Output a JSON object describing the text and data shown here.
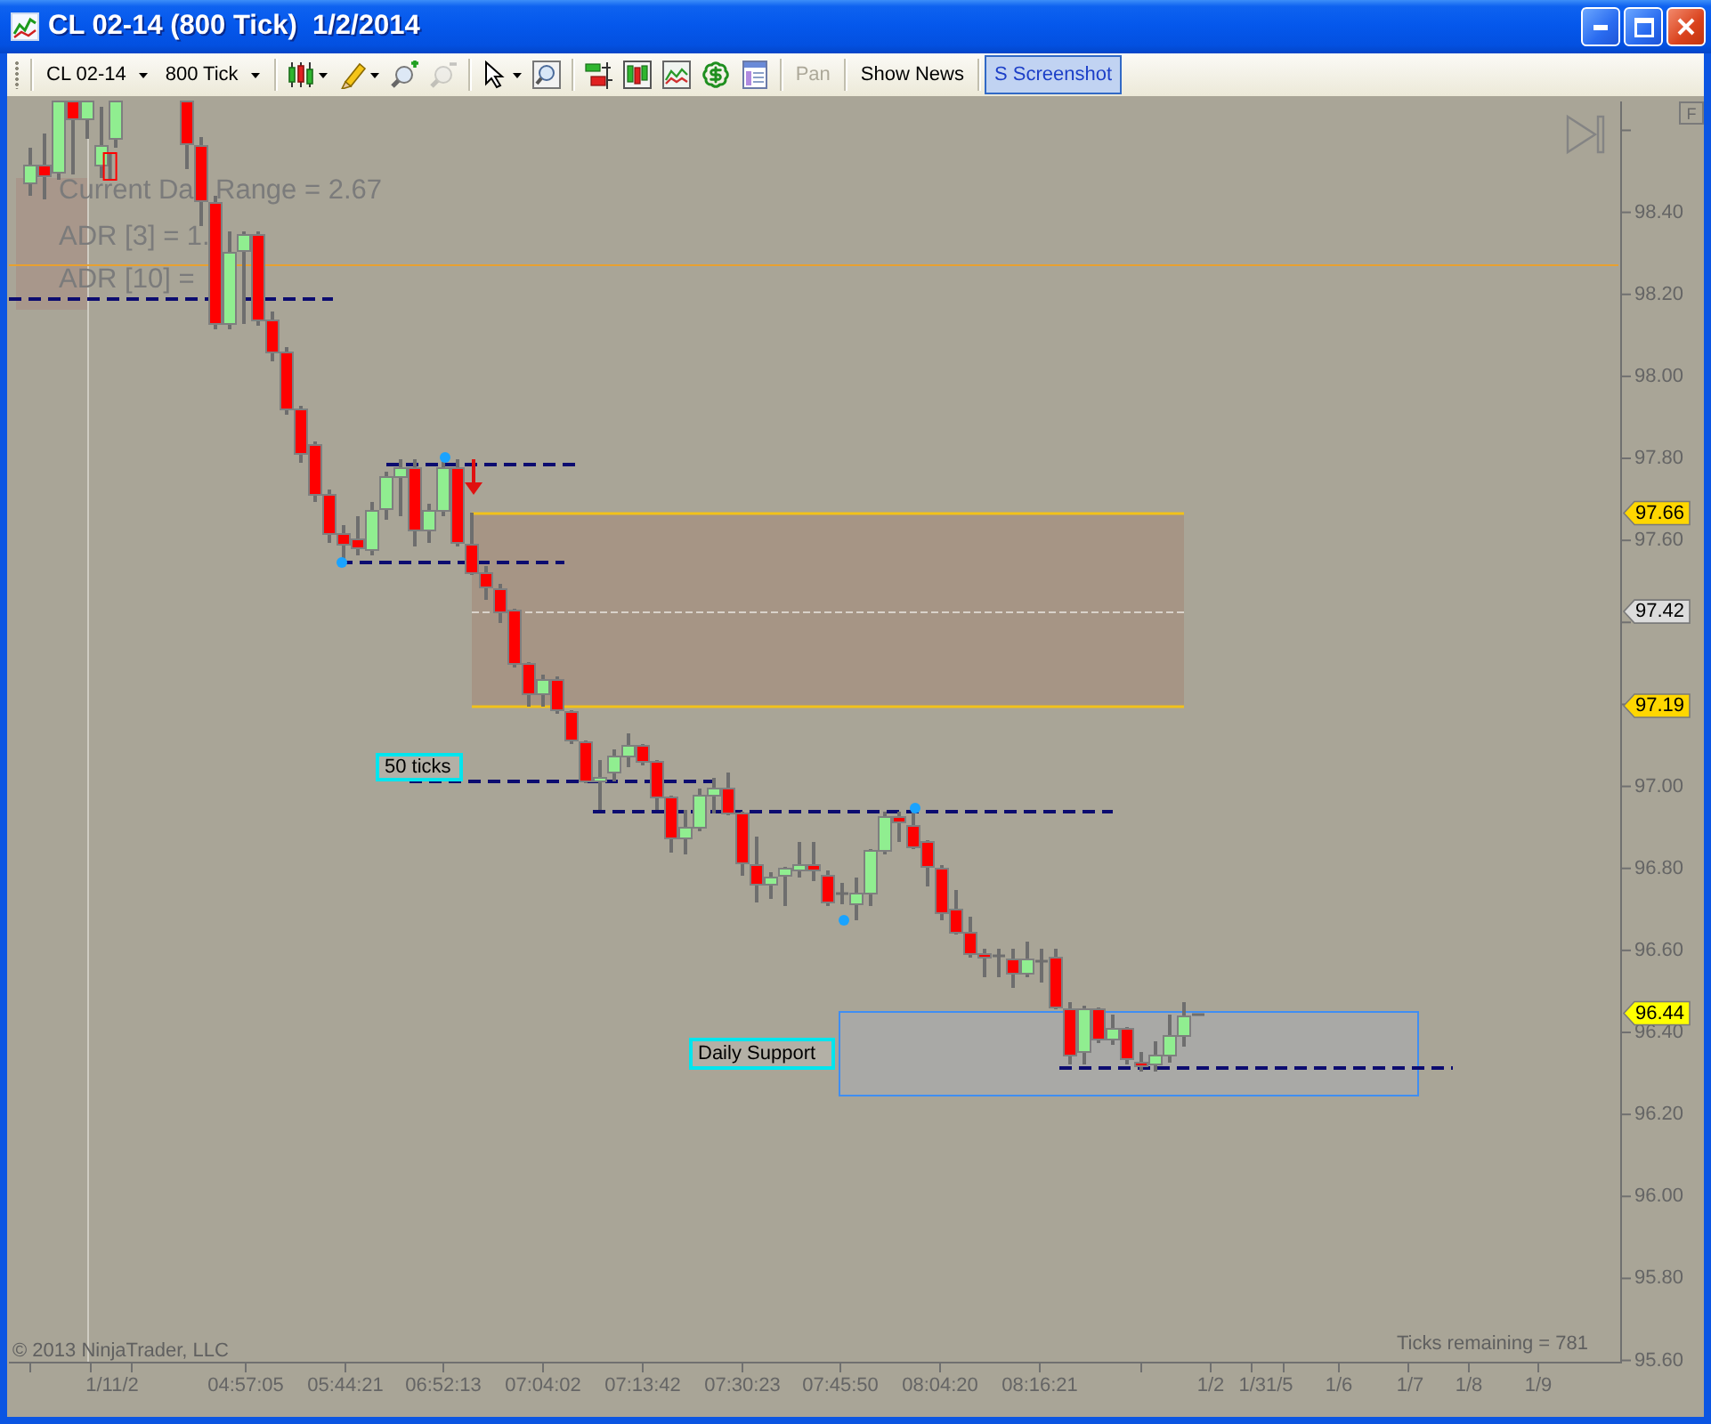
{
  "window": {
    "title": "CL 02-14 (800 Tick)  1/2/2014"
  },
  "toolbar": {
    "instrument": "CL 02-14",
    "interval": "800 Tick",
    "tool_groups": [
      [
        {
          "kind": "chart-style",
          "dropdown": true,
          "disabled": false
        },
        {
          "kind": "drawing",
          "dropdown": true,
          "disabled": false
        },
        {
          "kind": "zoom-in",
          "dropdown": false,
          "disabled": false
        },
        {
          "kind": "zoom-out",
          "dropdown": false,
          "disabled": true
        }
      ],
      [
        {
          "kind": "pointer",
          "dropdown": true,
          "disabled": false
        },
        {
          "kind": "zoom-box",
          "dropdown": false,
          "disabled": false
        }
      ],
      [
        {
          "kind": "data-series",
          "dropdown": false,
          "disabled": false
        },
        {
          "kind": "indicators",
          "dropdown": false,
          "disabled": false
        },
        {
          "kind": "strategies",
          "dropdown": false,
          "disabled": false
        },
        {
          "kind": "orders",
          "dropdown": false,
          "disabled": false
        },
        {
          "kind": "properties",
          "dropdown": false,
          "disabled": false
        }
      ]
    ],
    "buttons": [
      {
        "label": "Pan",
        "disabled": true,
        "highlighted": false
      },
      {
        "label": "Show News",
        "disabled": false,
        "highlighted": false
      },
      {
        "label": "S Screenshot",
        "disabled": false,
        "highlighted": true
      }
    ]
  },
  "chart": {
    "info_lines": [
      "Current Da",
      "Range = 2.67",
      "ADR [3] = 1.",
      "ADR [10] ="
    ],
    "annotations": [
      "50 ticks",
      "Daily Support"
    ],
    "price_axis": [
      "98.40",
      "98.20",
      "98.00",
      "97.80",
      "97.60",
      "97.00",
      "96.80",
      "96.60",
      "96.40",
      "96.20",
      "96.00",
      "95.80",
      "95.60"
    ],
    "price_markers": [
      {
        "price": "97.66",
        "color": "#ffd700"
      },
      {
        "price": "97.42",
        "color": "#dcdcdc"
      },
      {
        "price": "97.19",
        "color": "#ffd700"
      },
      {
        "price": "96.44",
        "color": "#ffff00"
      }
    ],
    "time_axis": [
      "1/11/2",
      "04:57:05",
      "05:44:21",
      "06:52:13",
      "07:04:02",
      "07:13:42",
      "07:30:23",
      "07:45:50",
      "08:04:20",
      "08:16:21",
      "1/2",
      "1/31/5",
      "1/6",
      "1/7",
      "1/8",
      "1/9"
    ],
    "ticks_remaining": "Ticks remaining = 781",
    "copyright": "© 2013 NinjaTrader, LLC",
    "scale_button": "F"
  }
}
